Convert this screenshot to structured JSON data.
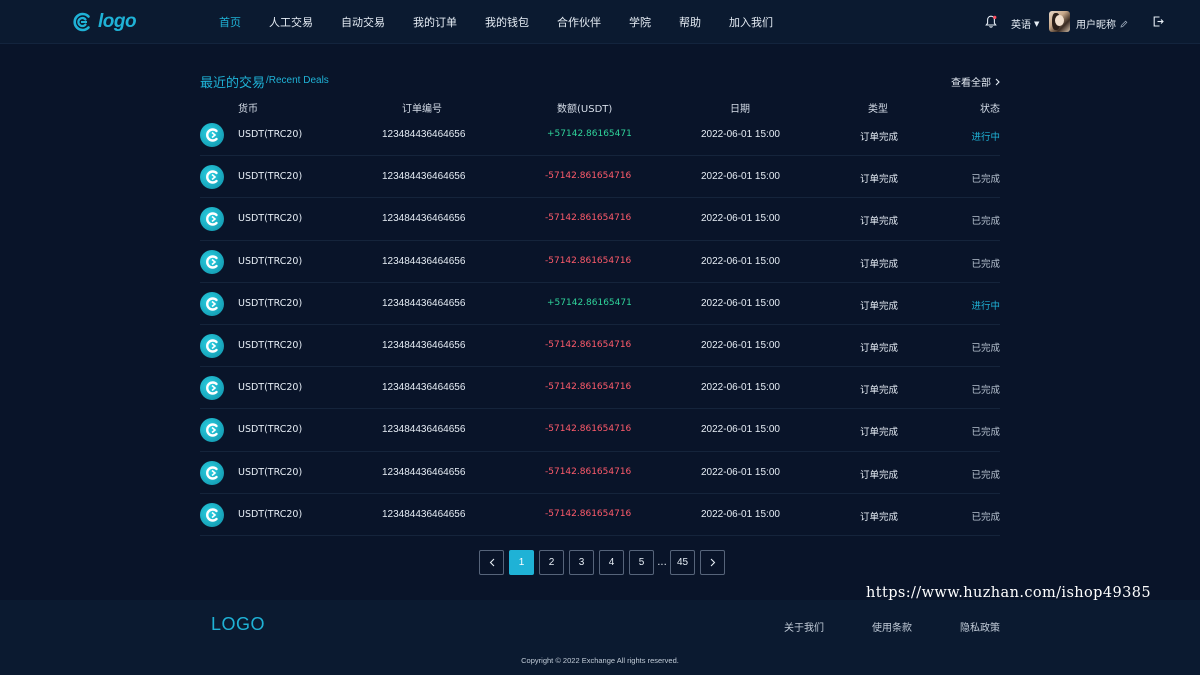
{
  "header": {
    "logo_text": "logo",
    "nav": [
      "首页",
      "人工交易",
      "自动交易",
      "我的订单",
      "我的钱包",
      "合作伙伴",
      "学院",
      "帮助",
      "加入我们"
    ],
    "active_nav": "首页",
    "language": "英语",
    "username": "用户昵称"
  },
  "section": {
    "title": "最近的交易",
    "subtitle": "/Recent Deals",
    "view_all": "查看全部"
  },
  "table": {
    "columns": [
      "货币",
      "订单编号",
      "数额(USDT)",
      "日期",
      "类型",
      "状态"
    ],
    "rows": [
      {
        "coin": "USDT(TRC20)",
        "order": "123484436464656",
        "amount": "+57142.86165471",
        "date": "2022-06-01 15:00",
        "type": "订单完成",
        "status": "进行中"
      },
      {
        "coin": "USDT(TRC20)",
        "order": "123484436464656",
        "amount": "-57142.861654716",
        "date": "2022-06-01 15:00",
        "type": "订单完成",
        "status": "已完成"
      },
      {
        "coin": "USDT(TRC20)",
        "order": "123484436464656",
        "amount": "-57142.861654716",
        "date": "2022-06-01 15:00",
        "type": "订单完成",
        "status": "已完成"
      },
      {
        "coin": "USDT(TRC20)",
        "order": "123484436464656",
        "amount": "-57142.861654716",
        "date": "2022-06-01 15:00",
        "type": "订单完成",
        "status": "已完成"
      },
      {
        "coin": "USDT(TRC20)",
        "order": "123484436464656",
        "amount": "+57142.86165471",
        "date": "2022-06-01 15:00",
        "type": "订单完成",
        "status": "进行中"
      },
      {
        "coin": "USDT(TRC20)",
        "order": "123484436464656",
        "amount": "-57142.861654716",
        "date": "2022-06-01 15:00",
        "type": "订单完成",
        "status": "已完成"
      },
      {
        "coin": "USDT(TRC20)",
        "order": "123484436464656",
        "amount": "-57142.861654716",
        "date": "2022-06-01 15:00",
        "type": "订单完成",
        "status": "已完成"
      },
      {
        "coin": "USDT(TRC20)",
        "order": "123484436464656",
        "amount": "-57142.861654716",
        "date": "2022-06-01 15:00",
        "type": "订单完成",
        "status": "已完成"
      },
      {
        "coin": "USDT(TRC20)",
        "order": "123484436464656",
        "amount": "-57142.861654716",
        "date": "2022-06-01 15:00",
        "type": "订单完成",
        "status": "已完成"
      },
      {
        "coin": "USDT(TRC20)",
        "order": "123484436464656",
        "amount": "-57142.861654716",
        "date": "2022-06-01 15:00",
        "type": "订单完成",
        "status": "已完成"
      }
    ]
  },
  "pagination": {
    "pages": [
      "1",
      "2",
      "3",
      "4",
      "5"
    ],
    "ellipsis": "...",
    "last": "45",
    "current": "1"
  },
  "watermark": "https://www.huzhan.com/ishop49385",
  "footer": {
    "logo": "LOGO",
    "links": [
      "关于我们",
      "使用条款",
      "隐私政策"
    ],
    "copyright": "Copyright © 2022 Exchange All rights reserved."
  },
  "colors": {
    "accent": "#1fb2d6",
    "positive": "#2fd39a",
    "negative": "#ff5b6b",
    "background": "#091429",
    "panel": "#0b1a30"
  }
}
